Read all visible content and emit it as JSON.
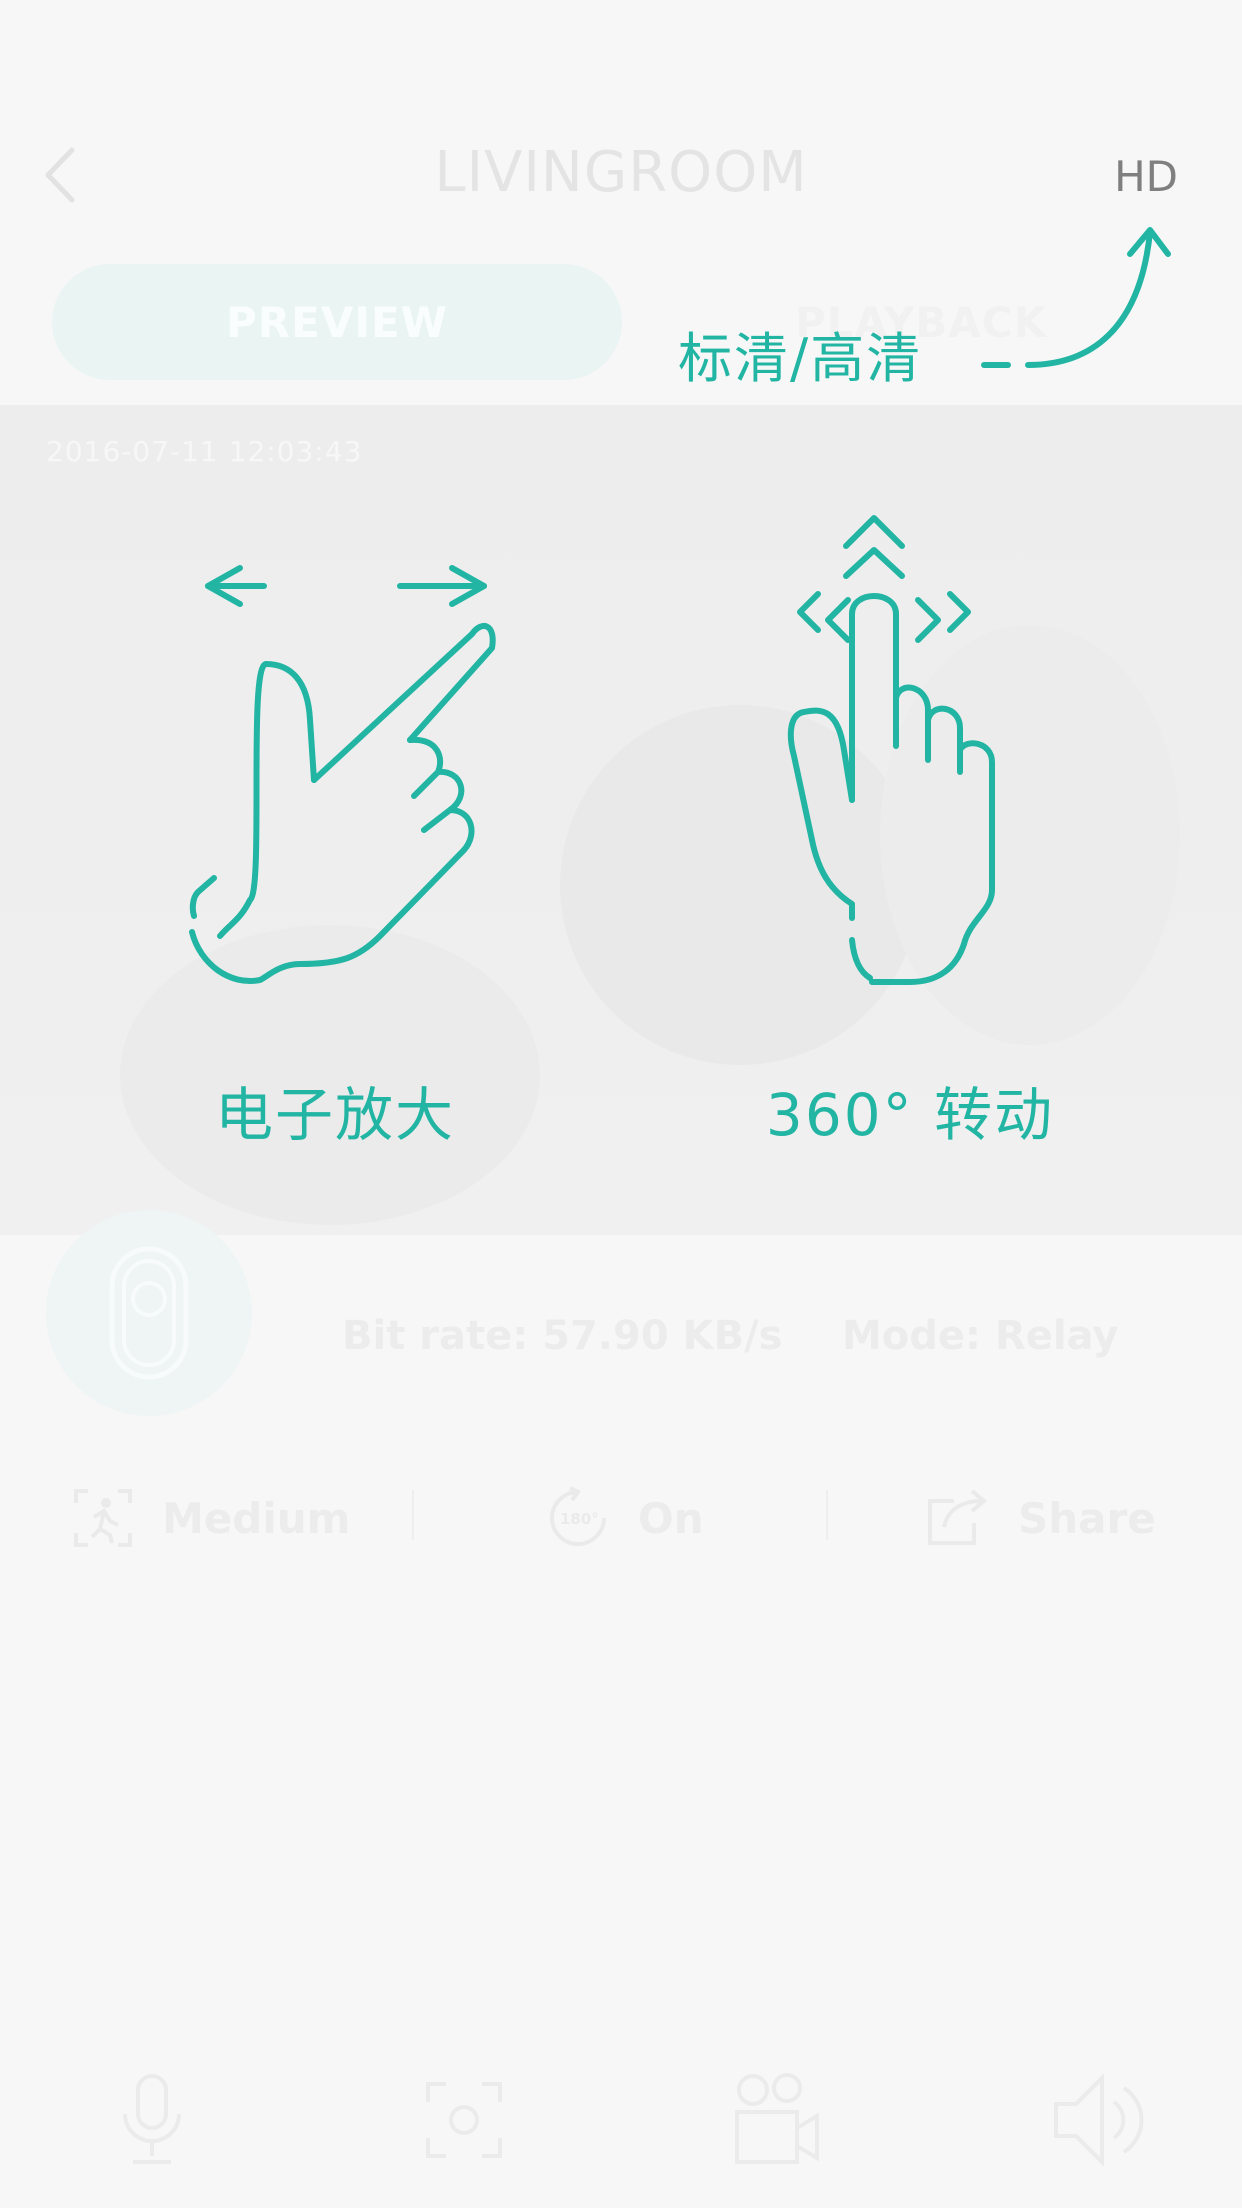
{
  "header": {
    "title": "LIVINGROOM",
    "quality_button": "HD"
  },
  "tabs": {
    "preview": "PREVIEW",
    "playback": "PLAYBACK"
  },
  "video": {
    "timestamp": "2016-07-11    12:03:43"
  },
  "info": {
    "bitrate": "Bit rate: 57.90 KB/s",
    "mode": "Mode: Relay"
  },
  "options": {
    "motion_label": "Medium",
    "rotate_label": "On",
    "rotate_icon_text": "180°",
    "share_label": "Share"
  },
  "guide": {
    "hd_toggle_hint": "标清/高清",
    "zoom_hint": "电子放大",
    "rotate_hint": "360° 转动"
  },
  "colors": {
    "accent": "#22b5a3",
    "background": "#f7f7f7"
  },
  "icons": {
    "back": "chevron-left-icon",
    "camera": "camera-device-icon",
    "motion": "motion-detection-icon",
    "rotate": "rotate-180-icon",
    "share": "share-icon",
    "mic": "microphone-icon",
    "snapshot": "snapshot-icon",
    "record": "video-record-icon",
    "speaker": "speaker-icon",
    "pinch": "pinch-zoom-gesture-icon",
    "swipe": "swipe-rotate-gesture-icon"
  }
}
